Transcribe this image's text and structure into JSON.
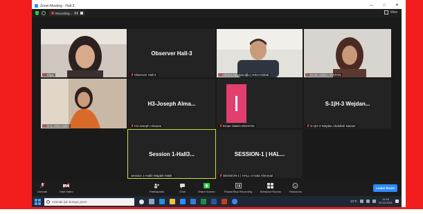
{
  "window": {
    "title": "Zoom Meeting - Hall-3",
    "min": "—",
    "max": "□",
    "close": "✕"
  },
  "recording": {
    "label": "Recording..."
  },
  "view": {
    "label": "View"
  },
  "tiles": [
    {
      "name": "Miya"
    },
    {
      "big": "Observer Hall-3",
      "name": "Observer Hall-3"
    },
    {
      "name": "Ahmet Meydanoğlu | KSU-Global"
    },
    {
      "name": "Eman Salem VAKFAN"
    },
    {
      "name": "H-4, Vinia Salim"
    },
    {
      "big": "H3-Joseph Alma...",
      "name": "H3-Joseph Almazat"
    },
    {
      "name": "Eman Salem EMAFAN"
    },
    {
      "big": "S-1|H-3 Wejdan...",
      "name": "S-1|H-3 Wejdan Abdullah Nasser"
    },
    {
      "big": "Session 1-Hall3...",
      "name": "Session 1-Hall3 Wajdah Malik"
    },
    {
      "big": "SESSION-1 | HAL...",
      "name": "SESSION-1 | HALL-3 Hala Ahmmad"
    }
  ],
  "controls": {
    "unmute": "Unmute",
    "start_video": "Start Video",
    "participants": "Participants",
    "participants_count": "10",
    "chat": "Chat",
    "share_screen": "Share Screen",
    "recording": "Pause/Stop Recording",
    "breakout": "Breakout Rooms",
    "reactions": "Reactions",
    "leave": "Leave Room"
  },
  "taskbar": {
    "search_placeholder": "Aramak için buraya yazın",
    "weather": "13°C",
    "time": "11:16",
    "date": "29.10.2021"
  }
}
